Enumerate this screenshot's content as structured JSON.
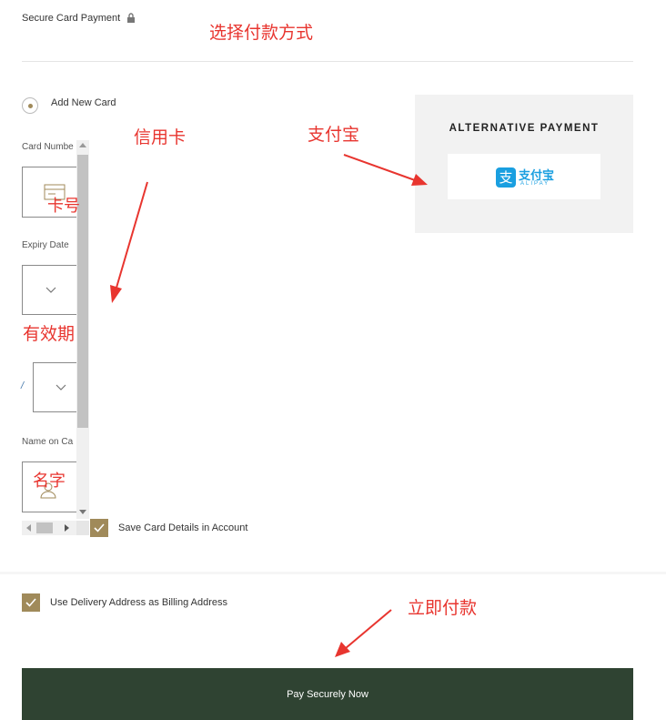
{
  "header": {
    "title": "Secure Card Payment",
    "lock_icon": "lock-icon"
  },
  "card_form": {
    "add_new_card_label": "Add New Card",
    "card_number_label": "Card Numbe",
    "expiry_label": "Expiry Date",
    "expiry_separator": "/",
    "name_label": "Name on Ca",
    "save_card_label": "Save Card Details in Account",
    "save_card_checked": true
  },
  "alternative": {
    "title": "ALTERNATIVE PAYMENT",
    "alipay_cn": "支付宝",
    "alipay_en": "ALIPAY",
    "alipay_mark": "支"
  },
  "billing": {
    "label": "Use Delivery Address as Billing Address",
    "checked": true
  },
  "pay_button": {
    "label": "Pay Securely Now"
  },
  "annotations": {
    "choose_payment": "选择付款方式",
    "credit_card": "信用卡",
    "alipay": "支付宝",
    "card_number": "卡号",
    "expiry": "有效期",
    "name": "名字",
    "pay_now": "立即付款"
  },
  "colors": {
    "accent": "#a08a5a",
    "button": "#2f4332",
    "annotation": "#e8352f",
    "alt_panel": "#f2f2f2",
    "alipay_blue": "#1a9fe0"
  }
}
